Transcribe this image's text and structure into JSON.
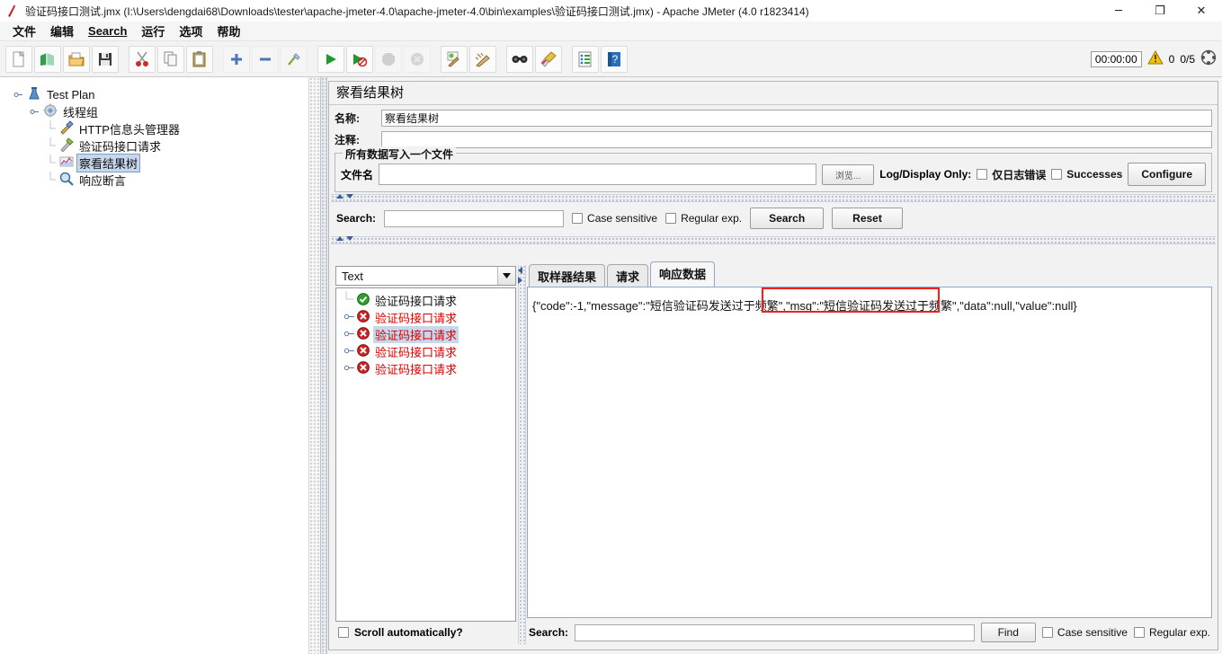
{
  "window": {
    "title": "验证码接口测试.jmx (I:\\Users\\dengdai68\\Downloads\\tester\\apache-jmeter-4.0\\apache-jmeter-4.0\\bin\\examples\\验证码接口测试.jmx) - Apache JMeter (4.0 r1823414)",
    "app_icon": "jmeter-feather-icon",
    "minimize": "─",
    "maximize": "❐",
    "close": "✕"
  },
  "menubar": {
    "items": [
      {
        "label": "文件",
        "mnemonic": ""
      },
      {
        "label": "编辑",
        "mnemonic": ""
      },
      {
        "label": "Search",
        "mnemonic": "S"
      },
      {
        "label": "运行",
        "mnemonic": ""
      },
      {
        "label": "选项",
        "mnemonic": ""
      },
      {
        "label": "帮助",
        "mnemonic": ""
      }
    ]
  },
  "toolbar": {
    "buttons": [
      {
        "name": "new-icon",
        "group": 0
      },
      {
        "name": "templates-icon",
        "group": 0
      },
      {
        "name": "open-icon",
        "group": 0
      },
      {
        "name": "save-icon",
        "group": 0
      },
      {
        "name": "cut-icon",
        "group": 1
      },
      {
        "name": "copy-icon",
        "group": 1
      },
      {
        "name": "paste-icon",
        "group": 1
      },
      {
        "name": "expand-all-icon",
        "group": 2
      },
      {
        "name": "collapse-all-icon",
        "group": 2
      },
      {
        "name": "toggle-icon",
        "group": 2
      },
      {
        "name": "start-icon",
        "group": 3
      },
      {
        "name": "start-no-pauses-icon",
        "group": 3
      },
      {
        "name": "stop-icon",
        "group": 3
      },
      {
        "name": "shutdown-icon",
        "group": 3
      },
      {
        "name": "clear-icon",
        "group": 4
      },
      {
        "name": "clear-all-icon",
        "group": 4
      },
      {
        "name": "search-icon",
        "group": 5
      },
      {
        "name": "search-reset-icon",
        "group": 5
      },
      {
        "name": "function-helper-icon",
        "group": 6
      },
      {
        "name": "help-icon",
        "group": 6
      }
    ],
    "timer": "00:00:00",
    "warning_icon": "warning-triangle-icon",
    "error_count": "0",
    "thread_count": "0/5",
    "remote_icon": "remote-engines-icon"
  },
  "test_plan_tree": {
    "nodes": [
      {
        "label": "Test Plan",
        "icon": "test-plan-icon",
        "depth": 0,
        "expanded": true,
        "selected": false,
        "color": "#101010"
      },
      {
        "label": "线程组",
        "icon": "thread-group-icon",
        "depth": 1,
        "expanded": true,
        "selected": false,
        "color": "#101010"
      },
      {
        "label": "HTTP信息头管理器",
        "icon": "header-manager-icon",
        "depth": 2,
        "expanded": false,
        "selected": false,
        "color": "#101010"
      },
      {
        "label": "验证码接口请求",
        "icon": "http-request-icon",
        "depth": 2,
        "expanded": false,
        "selected": false,
        "color": "#101010"
      },
      {
        "label": "察看结果树",
        "icon": "view-results-tree-icon",
        "depth": 2,
        "expanded": false,
        "selected": true,
        "color": "#101010"
      },
      {
        "label": "响应断言",
        "icon": "response-assertion-icon",
        "depth": 2,
        "expanded": false,
        "selected": false,
        "color": "#101010"
      }
    ]
  },
  "panel": {
    "title": "察看结果树",
    "name_label": "名称:",
    "name_value": "察看结果树",
    "comment_label": "注释:",
    "comment_value": "",
    "file_group_title": "所有数据写入一个文件",
    "filename_label": "文件名",
    "filename_value": "",
    "filename_placeholder": "",
    "browse_button": "浏览...",
    "log_display_only_label": "Log/Display Only:",
    "errors_only_checkbox": "仅日志错误",
    "errors_only_checked": false,
    "successes_checkbox": "Successes",
    "successes_checked": false,
    "configure_button": "Configure"
  },
  "search_bar": {
    "label": "Search:",
    "value": "",
    "case_sensitive_label": "Case sensitive",
    "case_sensitive_checked": false,
    "regular_exp_label": "Regular exp.",
    "regular_exp_checked": false,
    "search_button": "Search",
    "reset_button": "Reset"
  },
  "results": {
    "renderer_selected": "Text",
    "renderer_options": [
      "Text"
    ],
    "tree_items": [
      {
        "label": "验证码接口请求",
        "status": "success",
        "selected": false,
        "has_handle": false
      },
      {
        "label": "验证码接口请求",
        "status": "error",
        "selected": false,
        "has_handle": true
      },
      {
        "label": "验证码接口请求",
        "status": "error",
        "selected": true,
        "has_handle": true
      },
      {
        "label": "验证码接口请求",
        "status": "error",
        "selected": false,
        "has_handle": true
      },
      {
        "label": "验证码接口请求",
        "status": "error",
        "selected": false,
        "has_handle": true
      }
    ],
    "scroll_automatically_label": "Scroll automatically?",
    "scroll_automatically_checked": false,
    "tabs": [
      {
        "label": "取样器结果",
        "active": false
      },
      {
        "label": "请求",
        "active": false
      },
      {
        "label": "响应数据",
        "active": true
      }
    ],
    "response_body": "{\"code\":-1,\"message\":\"短信验证码发送过于频繁\",\"msg\":\"短信验证码发送过于频繁\",\"data\":null,\"value\":null}",
    "highlight_color": "#ef2020",
    "bottom_search": {
      "label": "Search:",
      "value": "",
      "find_button": "Find",
      "case_sensitive_label": "Case sensitive",
      "case_sensitive_checked": false,
      "regular_exp_label": "Regular exp.",
      "regular_exp_checked": false
    }
  },
  "colors": {
    "accent": "#3b5c8f",
    "selection": "#c7d7ec",
    "error_text": "#dd0000",
    "highlight_box": "#ef2020",
    "panel_bg": "#f2f2f2"
  }
}
